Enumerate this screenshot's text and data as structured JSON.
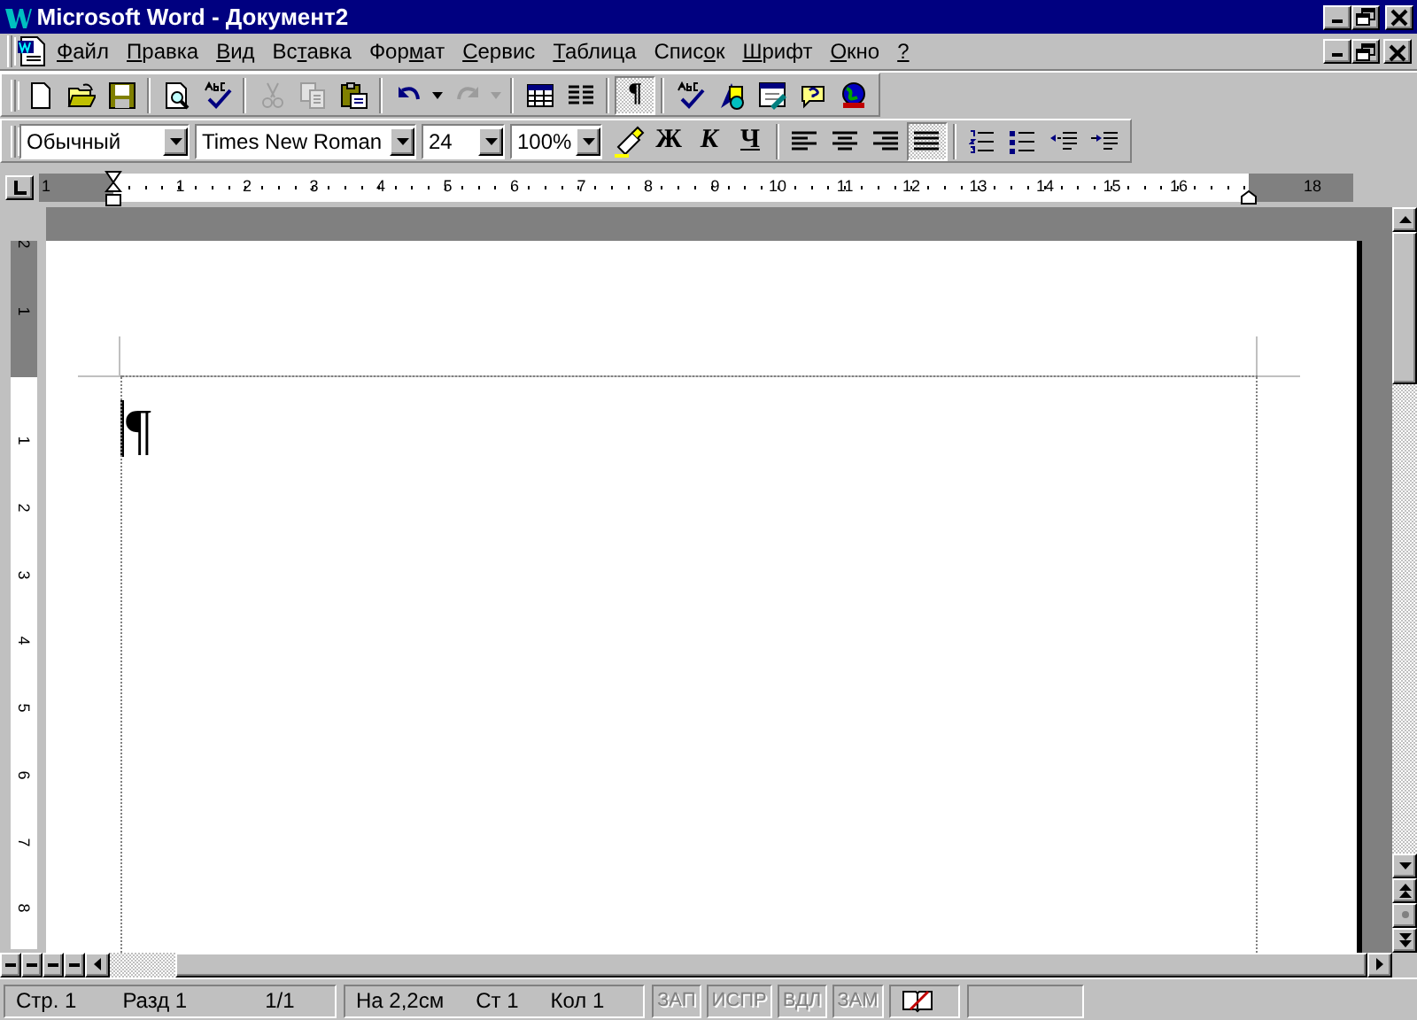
{
  "window": {
    "title": "Microsoft Word - Документ2"
  },
  "menu": [
    {
      "key": "Ф",
      "post": "айл"
    },
    {
      "key": "П",
      "post": "равка"
    },
    {
      "key": "В",
      "post": "ид"
    },
    {
      "pre": "Вс",
      "key": "т",
      "post": "авка"
    },
    {
      "pre": "Фор",
      "key": "м",
      "post": "ат"
    },
    {
      "key": "С",
      "post": "ервис"
    },
    {
      "key": "Т",
      "post": "аблица"
    },
    {
      "pre": "Спис",
      "key": "о",
      "post": "к"
    },
    {
      "key": "Ш",
      "post": "рифт"
    },
    {
      "key": "О",
      "post": "кно"
    },
    {
      "key": "?"
    }
  ],
  "standard_toolbar": [
    {
      "kind": "new",
      "disabled": false
    },
    {
      "kind": "open",
      "disabled": false
    },
    {
      "kind": "save",
      "disabled": false
    },
    {
      "kind": "separator"
    },
    {
      "kind": "preview",
      "disabled": false
    },
    {
      "kind": "spelling",
      "disabled": false
    },
    {
      "kind": "separator"
    },
    {
      "kind": "cut",
      "disabled": true
    },
    {
      "kind": "copy",
      "disabled": true
    },
    {
      "kind": "paste",
      "disabled": false
    },
    {
      "kind": "separator"
    },
    {
      "kind": "undo",
      "disabled": false
    },
    {
      "kind": "dropdown",
      "disabled": false
    },
    {
      "kind": "redo",
      "disabled": true
    },
    {
      "kind": "dropdown",
      "disabled": true
    },
    {
      "kind": "separator"
    },
    {
      "kind": "table",
      "disabled": false
    },
    {
      "kind": "columns",
      "disabled": false
    },
    {
      "kind": "separator"
    },
    {
      "kind": "glyph",
      "label": "¶",
      "pressed": true
    },
    {
      "kind": "separator"
    },
    {
      "kind": "spelling",
      "disabled": false
    },
    {
      "kind": "drawing",
      "disabled": false
    },
    {
      "kind": "form",
      "disabled": false
    },
    {
      "kind": "help",
      "disabled": false
    },
    {
      "kind": "globe",
      "disabled": false
    }
  ],
  "formatting_toolbar": [
    {
      "kind": "combo",
      "value": "Обычный"
    },
    {
      "kind": "combo",
      "value": "Times New Roman"
    },
    {
      "kind": "combo",
      "value": "24"
    },
    {
      "kind": "combo",
      "value": "100%"
    },
    {
      "kind": "highlight"
    },
    {
      "kind": "bold",
      "label": "Ж"
    },
    {
      "kind": "italic",
      "label": "К"
    },
    {
      "kind": "underline",
      "label": "Ч"
    },
    {
      "kind": "separator"
    },
    {
      "kind": "align-left",
      "pressed": false
    },
    {
      "kind": "align-center",
      "pressed": false
    },
    {
      "kind": "align-right",
      "pressed": false
    },
    {
      "kind": "align-justify",
      "pressed": true
    },
    {
      "kind": "separator"
    },
    {
      "kind": "numbering",
      "pressed": false
    },
    {
      "kind": "bullets",
      "pressed": false
    },
    {
      "kind": "outdent",
      "pressed": false
    },
    {
      "kind": "indent",
      "pressed": false
    }
  ],
  "ruler": {
    "left_margin_labels": [
      "1"
    ],
    "labels": [
      "1",
      "2",
      "3",
      "4",
      "5",
      "6",
      "7",
      "8",
      "9",
      "10",
      "11",
      "12",
      "13",
      "14",
      "15",
      "16"
    ],
    "right_margin_labels": [
      "18"
    ]
  },
  "vertical_ruler": {
    "top_margin_labels": [
      "2",
      "1"
    ],
    "labels": [
      "1",
      "2",
      "3",
      "4",
      "5",
      "6",
      "7",
      "8"
    ]
  },
  "document": {
    "paragraph_mark": "¶"
  },
  "status_bar": {
    "groups": [
      [
        "Стр. 1",
        "Разд 1",
        "1/1"
      ],
      [
        "На 2,2см",
        "Ст 1",
        "Кол 1"
      ]
    ],
    "modes": [
      {
        "label": "ЗАП",
        "on": false
      },
      {
        "label": "ИСПР",
        "on": false
      },
      {
        "label": "ВДЛ",
        "on": false
      },
      {
        "label": "ЗАМ",
        "on": false
      }
    ]
  }
}
